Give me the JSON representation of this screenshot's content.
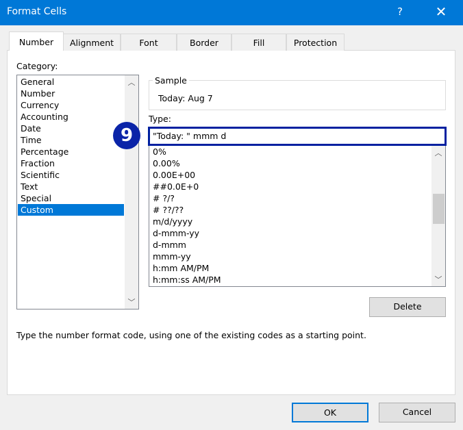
{
  "window": {
    "title": "Format Cells",
    "help_label": "?",
    "close_label": "✕"
  },
  "tabs": [
    {
      "label": "Number",
      "active": true
    },
    {
      "label": "Alignment"
    },
    {
      "label": "Font"
    },
    {
      "label": "Border"
    },
    {
      "label": "Fill"
    },
    {
      "label": "Protection"
    }
  ],
  "category": {
    "label": "Category:",
    "items": [
      "General",
      "Number",
      "Currency",
      "Accounting",
      "Date",
      "Time",
      "Percentage",
      "Fraction",
      "Scientific",
      "Text",
      "Special",
      "Custom"
    ],
    "selected": "Custom"
  },
  "sample": {
    "label": "Sample",
    "value": "Today:  Aug 7"
  },
  "type": {
    "label": "Type:",
    "value": "\"Today: \" mmm d",
    "items": [
      "0%",
      "0.00%",
      "0.00E+00",
      "##0.0E+0",
      "# ?/?",
      "# ??/??",
      "m/d/yyyy",
      "d-mmm-yy",
      "d-mmm",
      "mmm-yy",
      "h:mm AM/PM",
      "h:mm:ss AM/PM"
    ]
  },
  "step_badge": {
    "label": "9",
    "color": "#0b24a8"
  },
  "delete_label": "Delete",
  "hint": "Type the number format code, using one of the existing codes as a starting point.",
  "ok_label": "OK",
  "cancel_label": "Cancel",
  "colors": {
    "titlebar": "#0078d7",
    "selection": "#0078d7",
    "focus_border": "#0020a0"
  }
}
